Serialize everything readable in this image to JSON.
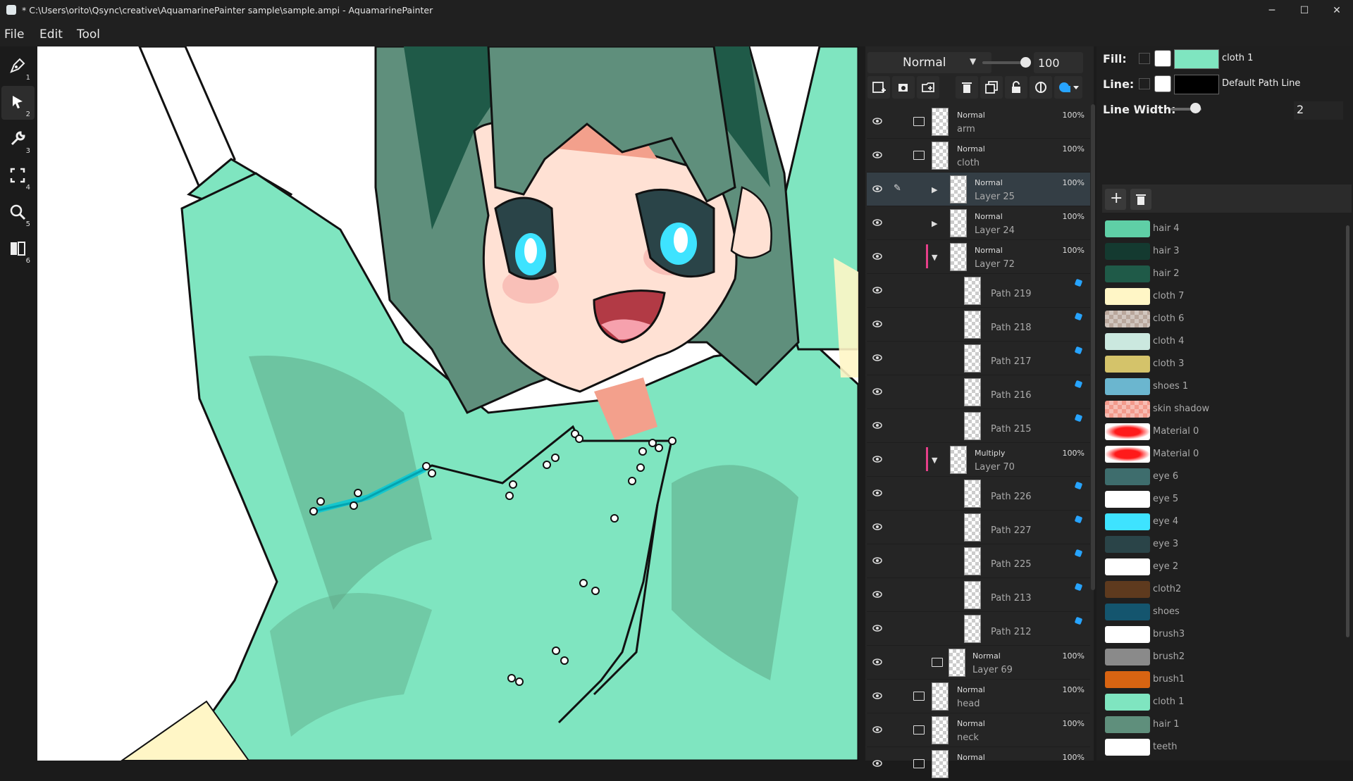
{
  "window": {
    "title": "* C:\\Users\\orito\\Qsync\\creative\\AquamarinePainter sample\\sample.ampi - AquamarinePainter",
    "minimize": "─",
    "maximize": "☐",
    "close": "✕"
  },
  "menu": [
    "File",
    "Edit",
    "Tool"
  ],
  "tools": [
    {
      "icon": "pen-icon",
      "num": "1"
    },
    {
      "icon": "select-arrow-icon",
      "num": "2",
      "selected": true
    },
    {
      "icon": "wrench-icon",
      "num": "3"
    },
    {
      "icon": "transform-icon",
      "num": "4"
    },
    {
      "icon": "zoom-icon",
      "num": "5"
    },
    {
      "icon": "split-view-icon",
      "num": "6"
    }
  ],
  "layers_panel": {
    "blend_mode": "Normal",
    "opacity": "100",
    "buttons": [
      "new-layer-icon",
      "new-folder-icon",
      "duplicate-layer-icon",
      "delete-icon",
      "copy-icon",
      "lock-icon",
      "clip-icon",
      "fill-shape-icon"
    ],
    "rows": [
      {
        "kind": "folder",
        "mode": "Normal",
        "name": "arm",
        "opacity": "100%"
      },
      {
        "kind": "folder-open",
        "mode": "Normal",
        "name": "cloth",
        "opacity": "100%"
      },
      {
        "kind": "layer",
        "mode": "Normal",
        "name": "Layer 25",
        "opacity": "100%",
        "selected": true,
        "expand": "▶"
      },
      {
        "kind": "layer",
        "mode": "Normal",
        "name": "Layer 24",
        "opacity": "100%",
        "expand": "▶"
      },
      {
        "kind": "layer",
        "mode": "Normal",
        "name": "Layer 72",
        "opacity": "100%",
        "expand": "▼"
      },
      {
        "kind": "path",
        "name": "Path 219"
      },
      {
        "kind": "path",
        "name": "Path 218"
      },
      {
        "kind": "path",
        "name": "Path 217"
      },
      {
        "kind": "path",
        "name": "Path 216"
      },
      {
        "kind": "path",
        "name": "Path 215"
      },
      {
        "kind": "layer",
        "mode": "Multiply",
        "name": "Layer 70",
        "opacity": "100%",
        "expand": "▼"
      },
      {
        "kind": "path",
        "name": "Path 226"
      },
      {
        "kind": "path",
        "name": "Path 227"
      },
      {
        "kind": "path",
        "name": "Path 225"
      },
      {
        "kind": "path",
        "name": "Path 213"
      },
      {
        "kind": "path",
        "name": "Path 212"
      },
      {
        "kind": "folder-sub",
        "mode": "Normal",
        "name": "Layer 69",
        "opacity": "100%"
      },
      {
        "kind": "folder",
        "mode": "Normal",
        "name": "head",
        "opacity": "100%"
      },
      {
        "kind": "folder",
        "mode": "Normal",
        "name": "neck",
        "opacity": "100%"
      },
      {
        "kind": "folder",
        "mode": "Normal",
        "name": "",
        "opacity": "100%"
      }
    ]
  },
  "properties": {
    "fill_label": "Fill:",
    "fill_name": "cloth 1",
    "fill_color": "#7fe5c0",
    "line_label": "Line:",
    "line_name": "Default Path Line",
    "line_color": "#000000",
    "line_width_label": "Line Width:",
    "line_width": "2",
    "add_material": "+",
    "delete_material": "trash-icon"
  },
  "materials": [
    {
      "name": "hair 4",
      "color": "#5fcfa6"
    },
    {
      "name": "hair 3",
      "color": "#143a30"
    },
    {
      "name": "hair 2",
      "color": "#1f5a48"
    },
    {
      "name": "cloth 7",
      "color": "#fff6c6"
    },
    {
      "name": "cloth 6",
      "color": "#b9a79c",
      "pattern": "check"
    },
    {
      "name": "cloth 4",
      "color": "#cbe8df"
    },
    {
      "name": "cloth 3",
      "color": "#d4c36a"
    },
    {
      "name": "shoes 1",
      "color": "#6bb6cf"
    },
    {
      "name": "skin shadow",
      "color": "#f39a8c",
      "pattern": "check"
    },
    {
      "name": "Material 0",
      "color": "#ff1a1a",
      "pattern": "blob"
    },
    {
      "name": "Material 0",
      "color": "#ff1a1a",
      "pattern": "blob"
    },
    {
      "name": "eye 6",
      "color": "#3e6d6d"
    },
    {
      "name": "eye 5",
      "color": "#ffffff"
    },
    {
      "name": "eye 4",
      "color": "#3ee3ff"
    },
    {
      "name": "eye 3",
      "color": "#2a4448"
    },
    {
      "name": "eye 2",
      "color": "#ffffff"
    },
    {
      "name": "cloth2",
      "color": "#5e3a1e"
    },
    {
      "name": "shoes",
      "color": "#14556e"
    },
    {
      "name": "brush3",
      "color": "#ffffff"
    },
    {
      "name": "brush2",
      "color": "#8a8a8a"
    },
    {
      "name": "brush1",
      "color": "#d86412"
    },
    {
      "name": "cloth 1",
      "color": "#7fe5c0"
    },
    {
      "name": "hair 1",
      "color": "#5f8f7c"
    },
    {
      "name": "teeth",
      "color": "#ffffff"
    }
  ]
}
